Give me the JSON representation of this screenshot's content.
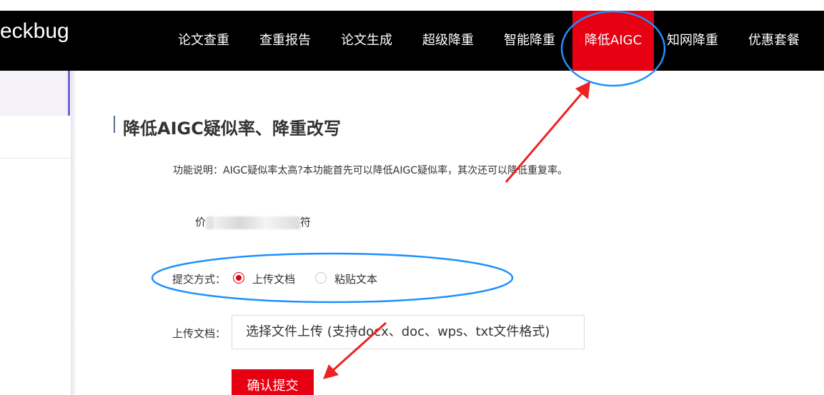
{
  "header": {
    "logo": "eckbug",
    "nav": [
      {
        "label": "论文查重",
        "active": false
      },
      {
        "label": "查重报告",
        "active": false
      },
      {
        "label": "论文生成",
        "active": false
      },
      {
        "label": "超级降重",
        "active": false
      },
      {
        "label": "智能降重",
        "active": false
      },
      {
        "label": "降低AIGC",
        "active": true
      },
      {
        "label": "知网降重",
        "active": false
      },
      {
        "label": "优惠套餐",
        "active": false
      }
    ]
  },
  "main": {
    "title": "降低AIGC疑似率、降重改写",
    "description": "功能说明：AIGC疑似率太高?本功能首先可以降低AIGC疑似率，其次还可以降低重复率。",
    "price_label": "价",
    "price_suffix": "符",
    "submit_method_label": "提交方式：",
    "submit_options": [
      {
        "label": "上传文档",
        "checked": true
      },
      {
        "label": "粘贴文本",
        "checked": false
      }
    ],
    "upload_label": "上传文档：",
    "upload_button": "选择文件上传   (支持docx、doc、wps、txt文件格式)",
    "confirm_button": "确认提交"
  },
  "colors": {
    "accent": "#e60012",
    "annotation": "#1e90ff"
  }
}
